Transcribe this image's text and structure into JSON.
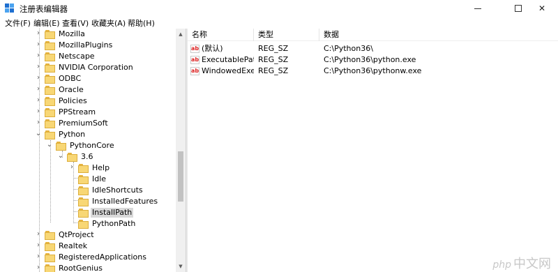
{
  "window": {
    "title": "注册表编辑器"
  },
  "menu": [
    "文件(F)",
    "编辑(E)",
    "查看(V)",
    "收藏夹(A)",
    "帮助(H)"
  ],
  "tree": [
    {
      "label": "Mozilla"
    },
    {
      "label": "MozillaPlugins"
    },
    {
      "label": "Netscape"
    },
    {
      "label": "NVIDIA Corporation"
    },
    {
      "label": "ODBC"
    },
    {
      "label": "Oracle"
    },
    {
      "label": "Policies"
    },
    {
      "label": "PPStream"
    },
    {
      "label": "PremiumSoft"
    },
    {
      "label": "Python"
    },
    {
      "label": "PythonCore"
    },
    {
      "label": "3.6"
    },
    {
      "label": "Help"
    },
    {
      "label": "Idle"
    },
    {
      "label": "IdleShortcuts"
    },
    {
      "label": "InstalledFeatures"
    },
    {
      "label": "InstallPath",
      "selected": true
    },
    {
      "label": "PythonPath"
    },
    {
      "label": "QtProject"
    },
    {
      "label": "Realtek"
    },
    {
      "label": "RegisteredApplications"
    },
    {
      "label": "RootGenius"
    }
  ],
  "columns": {
    "name": "名称",
    "type": "类型",
    "data": "数据"
  },
  "values": [
    {
      "name": "(默认)",
      "type": "REG_SZ",
      "data": "C:\\Python36\\"
    },
    {
      "name": "ExecutablePath",
      "type": "REG_SZ",
      "data": "C:\\Python36\\python.exe"
    },
    {
      "name": "WindowedExe...",
      "type": "REG_SZ",
      "data": "C:\\Python36\\pythonw.exe"
    }
  ],
  "icons": {
    "value_icon": "ab"
  },
  "watermark": {
    "brand": "php",
    "text": "中文网"
  },
  "colors": {
    "folder": "#f8d775",
    "selection": "#d9d9d9"
  }
}
